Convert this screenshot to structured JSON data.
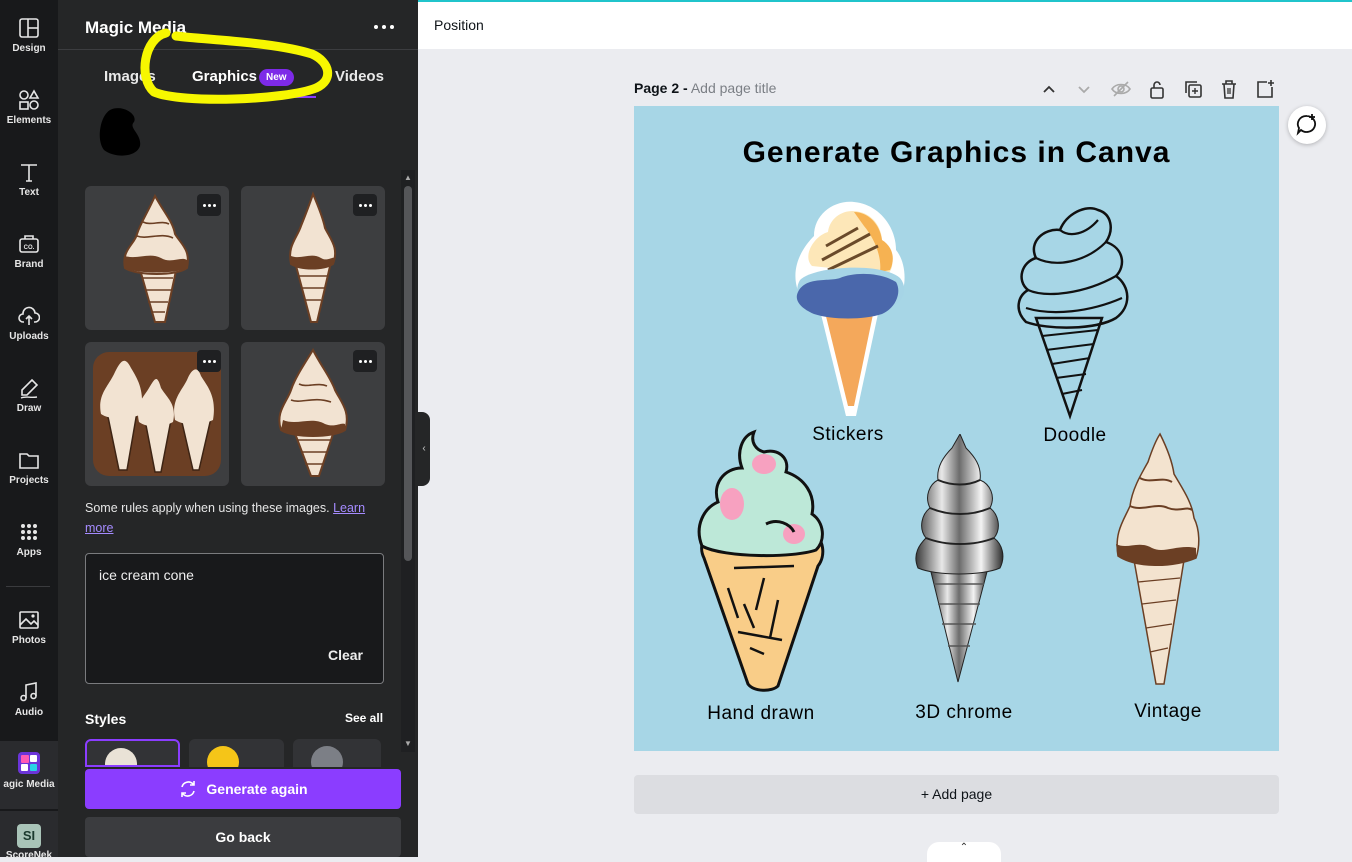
{
  "rail": {
    "items": [
      {
        "label": "Design",
        "icon": "layout-icon"
      },
      {
        "label": "Elements",
        "icon": "shapes-icon"
      },
      {
        "label": "Text",
        "icon": "text-icon"
      },
      {
        "label": "Brand",
        "icon": "brand-icon"
      },
      {
        "label": "Uploads",
        "icon": "cloud-upload-icon"
      },
      {
        "label": "Draw",
        "icon": "pen-icon"
      },
      {
        "label": "Projects",
        "icon": "folder-icon"
      },
      {
        "label": "Apps",
        "icon": "apps-grid-icon"
      },
      {
        "label": "Photos",
        "icon": "image-icon"
      },
      {
        "label": "Audio",
        "icon": "music-note-icon"
      },
      {
        "label": "agic Media",
        "icon": "magic-media-icon"
      },
      {
        "label": "ScoreNek",
        "icon": "app-si-icon",
        "badge": "SI"
      }
    ]
  },
  "panel": {
    "title": "Magic Media",
    "tabs": [
      {
        "label": "Images"
      },
      {
        "label": "Graphics",
        "active": true
      },
      {
        "label": "Videos"
      }
    ],
    "new_badge": "New",
    "rules_text": "Some rules apply when using these images.",
    "rules_link": "Learn more",
    "prompt_value": "ice cream cone",
    "clear_label": "Clear",
    "styles_title": "Styles",
    "see_all_label": "See all",
    "generate_label": "Generate again",
    "go_back_label": "Go back"
  },
  "topbar": {
    "position_label": "Position"
  },
  "page": {
    "label": "Page 2 -",
    "title_placeholder": "Add page title",
    "heading": "Generate Graphics in Canva",
    "cone_labels": {
      "stickers": "Stickers",
      "doodle": "Doodle",
      "hand_drawn": "Hand drawn",
      "chrome": "3D chrome",
      "vintage": "Vintage"
    },
    "add_page_label": "+ Add page"
  },
  "colors": {
    "accent": "#8b3dff",
    "canvas_bg": "#a7d6e6",
    "panel_bg": "#252627",
    "rail_bg": "#18191b",
    "highlight": "#f7f700"
  }
}
